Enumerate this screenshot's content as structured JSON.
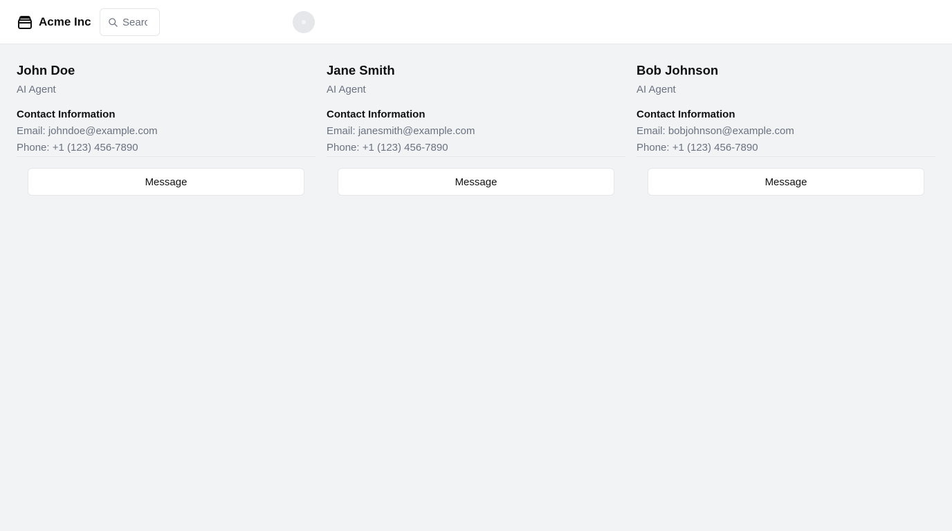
{
  "header": {
    "brand_name": "Acme Inc",
    "brand_icon": "package-icon",
    "search_placeholder": "Search",
    "avatar_icon": "user-avatar-icon"
  },
  "agents": [
    {
      "name": "John Doe",
      "role": "AI Agent",
      "contact_title": "Contact Information",
      "email": "Email: johndoe@example.com",
      "phone": "Phone: +1 (123) 456-7890",
      "button_label": "Message"
    },
    {
      "name": "Jane Smith",
      "role": "AI Agent",
      "contact_title": "Contact Information",
      "email": "Email: janesmith@example.com",
      "phone": "Phone: +1 (123) 456-7890",
      "button_label": "Message"
    },
    {
      "name": "Bob Johnson",
      "role": "AI Agent",
      "contact_title": "Contact Information",
      "email": "Email: bobjohnson@example.com",
      "phone": "Phone: +1 (123) 456-7890",
      "button_label": "Message"
    }
  ],
  "colors": {
    "page_background": "#f2f3f5",
    "header_background": "#ffffff",
    "border": "#e5e7eb",
    "muted_text": "#6b7280"
  }
}
